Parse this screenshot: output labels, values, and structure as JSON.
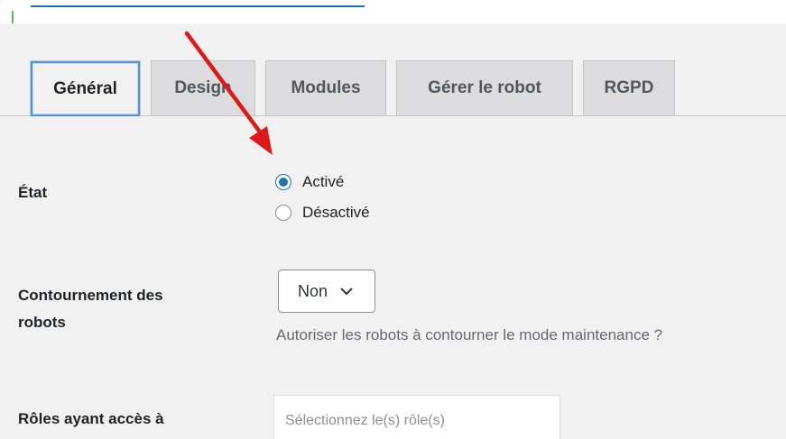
{
  "tabs": [
    {
      "label": "Général",
      "active": true
    },
    {
      "label": "Design",
      "active": false
    },
    {
      "label": "Modules",
      "active": false
    },
    {
      "label": "Gérer le robot",
      "active": false
    },
    {
      "label": "RGPD",
      "active": false
    }
  ],
  "fields": {
    "etat": {
      "label": "État",
      "options": [
        {
          "label": "Activé",
          "checked": true
        },
        {
          "label": "Désactivé",
          "checked": false
        }
      ]
    },
    "bypass": {
      "label_line1": "Contournement des",
      "label_line2": "robots",
      "select_value": "Non",
      "helper": "Autoriser les robots à contourner le mode maintenance ?"
    },
    "roles": {
      "label": "Rôles ayant accès à",
      "placeholder": "Sélectionnez le(s) rôle(s)"
    }
  },
  "colors": {
    "accent": "#2271b1",
    "annotation_arrow": "#dd1a1a"
  }
}
